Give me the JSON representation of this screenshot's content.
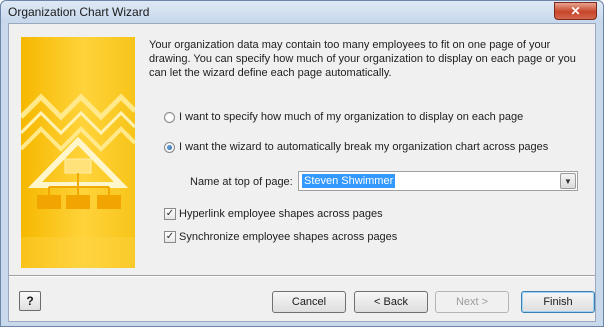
{
  "window": {
    "title": "Organization Chart Wizard",
    "close_glyph": "✕"
  },
  "intro_text": "Your organization data may contain too many employees to fit on one page of your drawing.  You can specify how much of your organization to display on each page or you can let the wizard define each page automatically.",
  "options": {
    "manual_label": "I want to specify how much of my organization to display on each page",
    "manual_selected": false,
    "auto_label": "I want the wizard to automatically break my organization chart across pages",
    "auto_selected": true
  },
  "name_field": {
    "label": "Name at top of page:",
    "value": "Steven Shwimmer"
  },
  "checkboxes": {
    "hyperlink_label": "Hyperlink employee shapes across pages",
    "hyperlink_checked": true,
    "synchronize_label": "Synchronize employee shapes across pages",
    "synchronize_checked": true
  },
  "buttons": {
    "help": "?",
    "cancel": "Cancel",
    "back": "< Back",
    "next": "Next >",
    "finish": "Finish"
  },
  "check_glyph": "✓",
  "combo_arrow_glyph": "▼",
  "colors": {
    "banner_yellow": "#f7c41a",
    "selection_blue": "#3399ff",
    "close_red": "#c7452a"
  }
}
